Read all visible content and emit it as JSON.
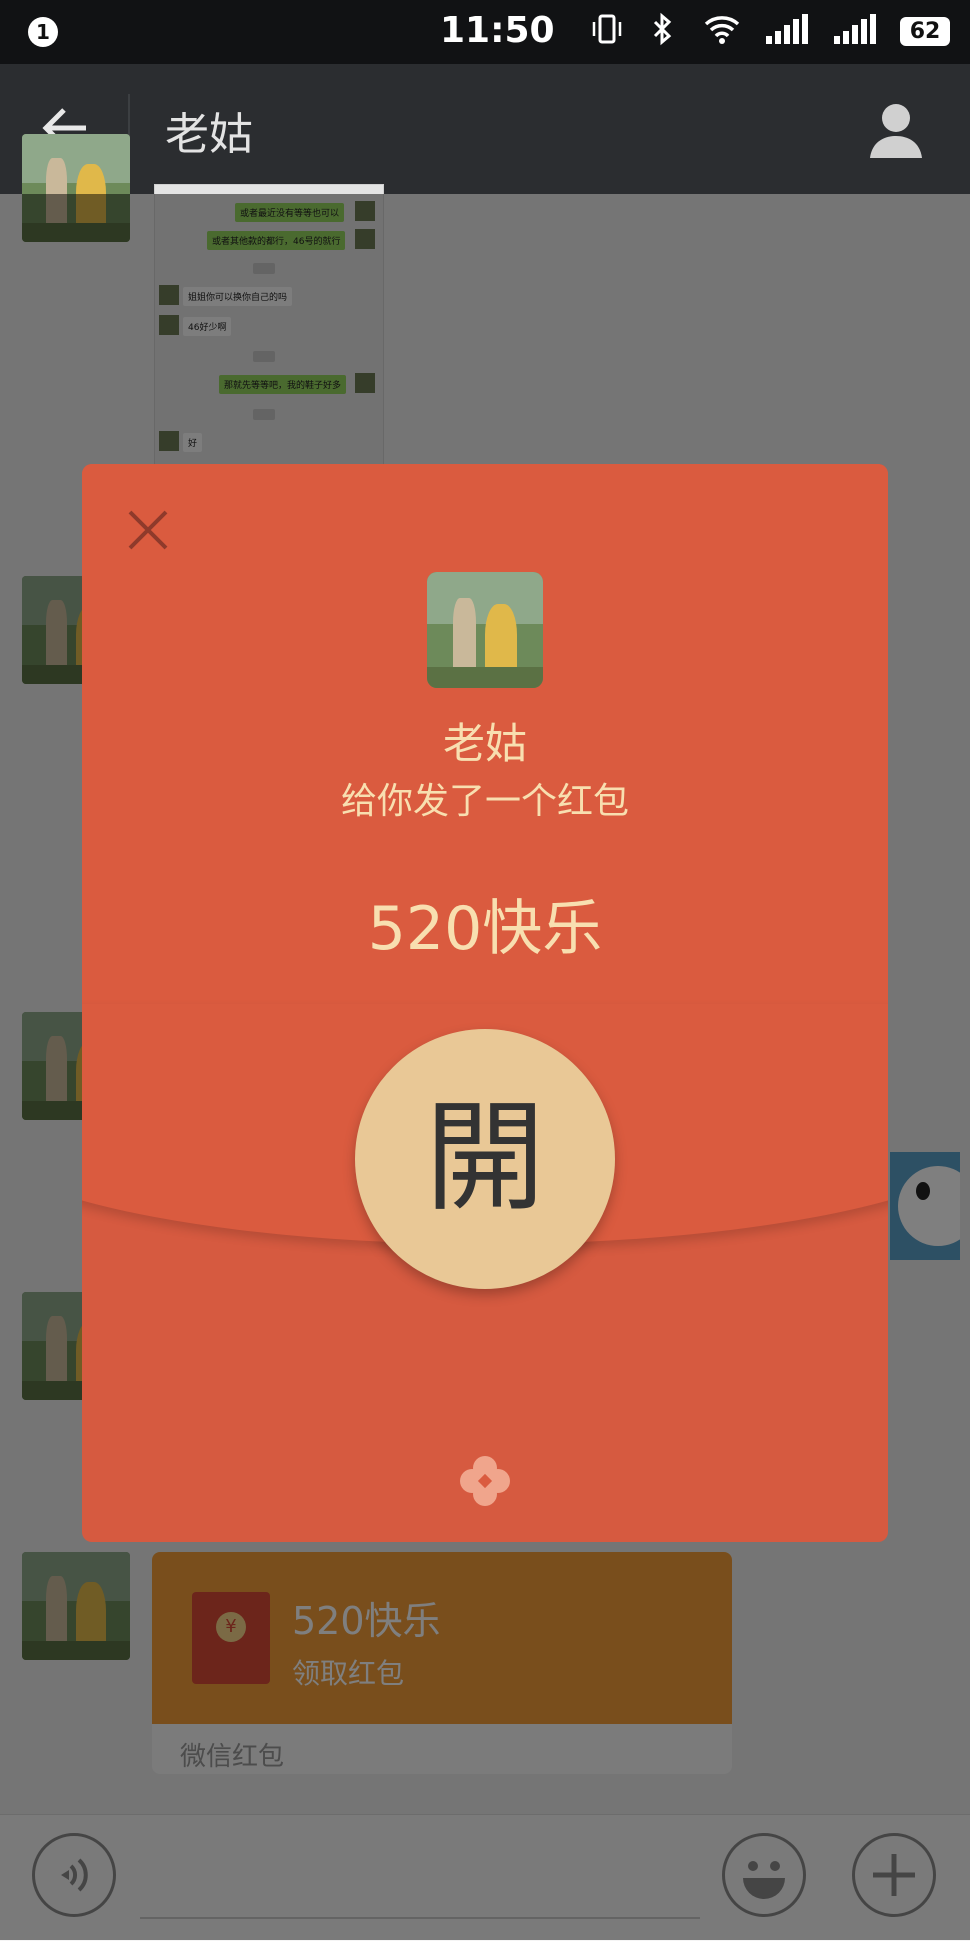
{
  "status_bar": {
    "notification_count": "1",
    "time": "11:50",
    "battery": "62"
  },
  "header": {
    "title": "老姑"
  },
  "chat": {
    "screenshot_lines": [
      "或者最近没有等等也可以",
      "或者其他款的都行，46号的就行",
      "姐姐你可以换你自己的吗",
      "46好少啊",
      "那就先等等吧，我的鞋子好多",
      "好"
    ],
    "red_packet_message": {
      "title": "520快乐",
      "action": "领取红包",
      "footer": "微信红包",
      "coin_symbol": "¥"
    }
  },
  "modal": {
    "sender_name": "老姑",
    "sender_line": "给你发了一个红包",
    "greeting": "520快乐",
    "open_label": "開"
  },
  "colors": {
    "modal_red": "#da5b3f",
    "button_gold": "#e9c896",
    "text_gold": "#f8dfb0",
    "red_packet_orange": "#f29d38"
  }
}
